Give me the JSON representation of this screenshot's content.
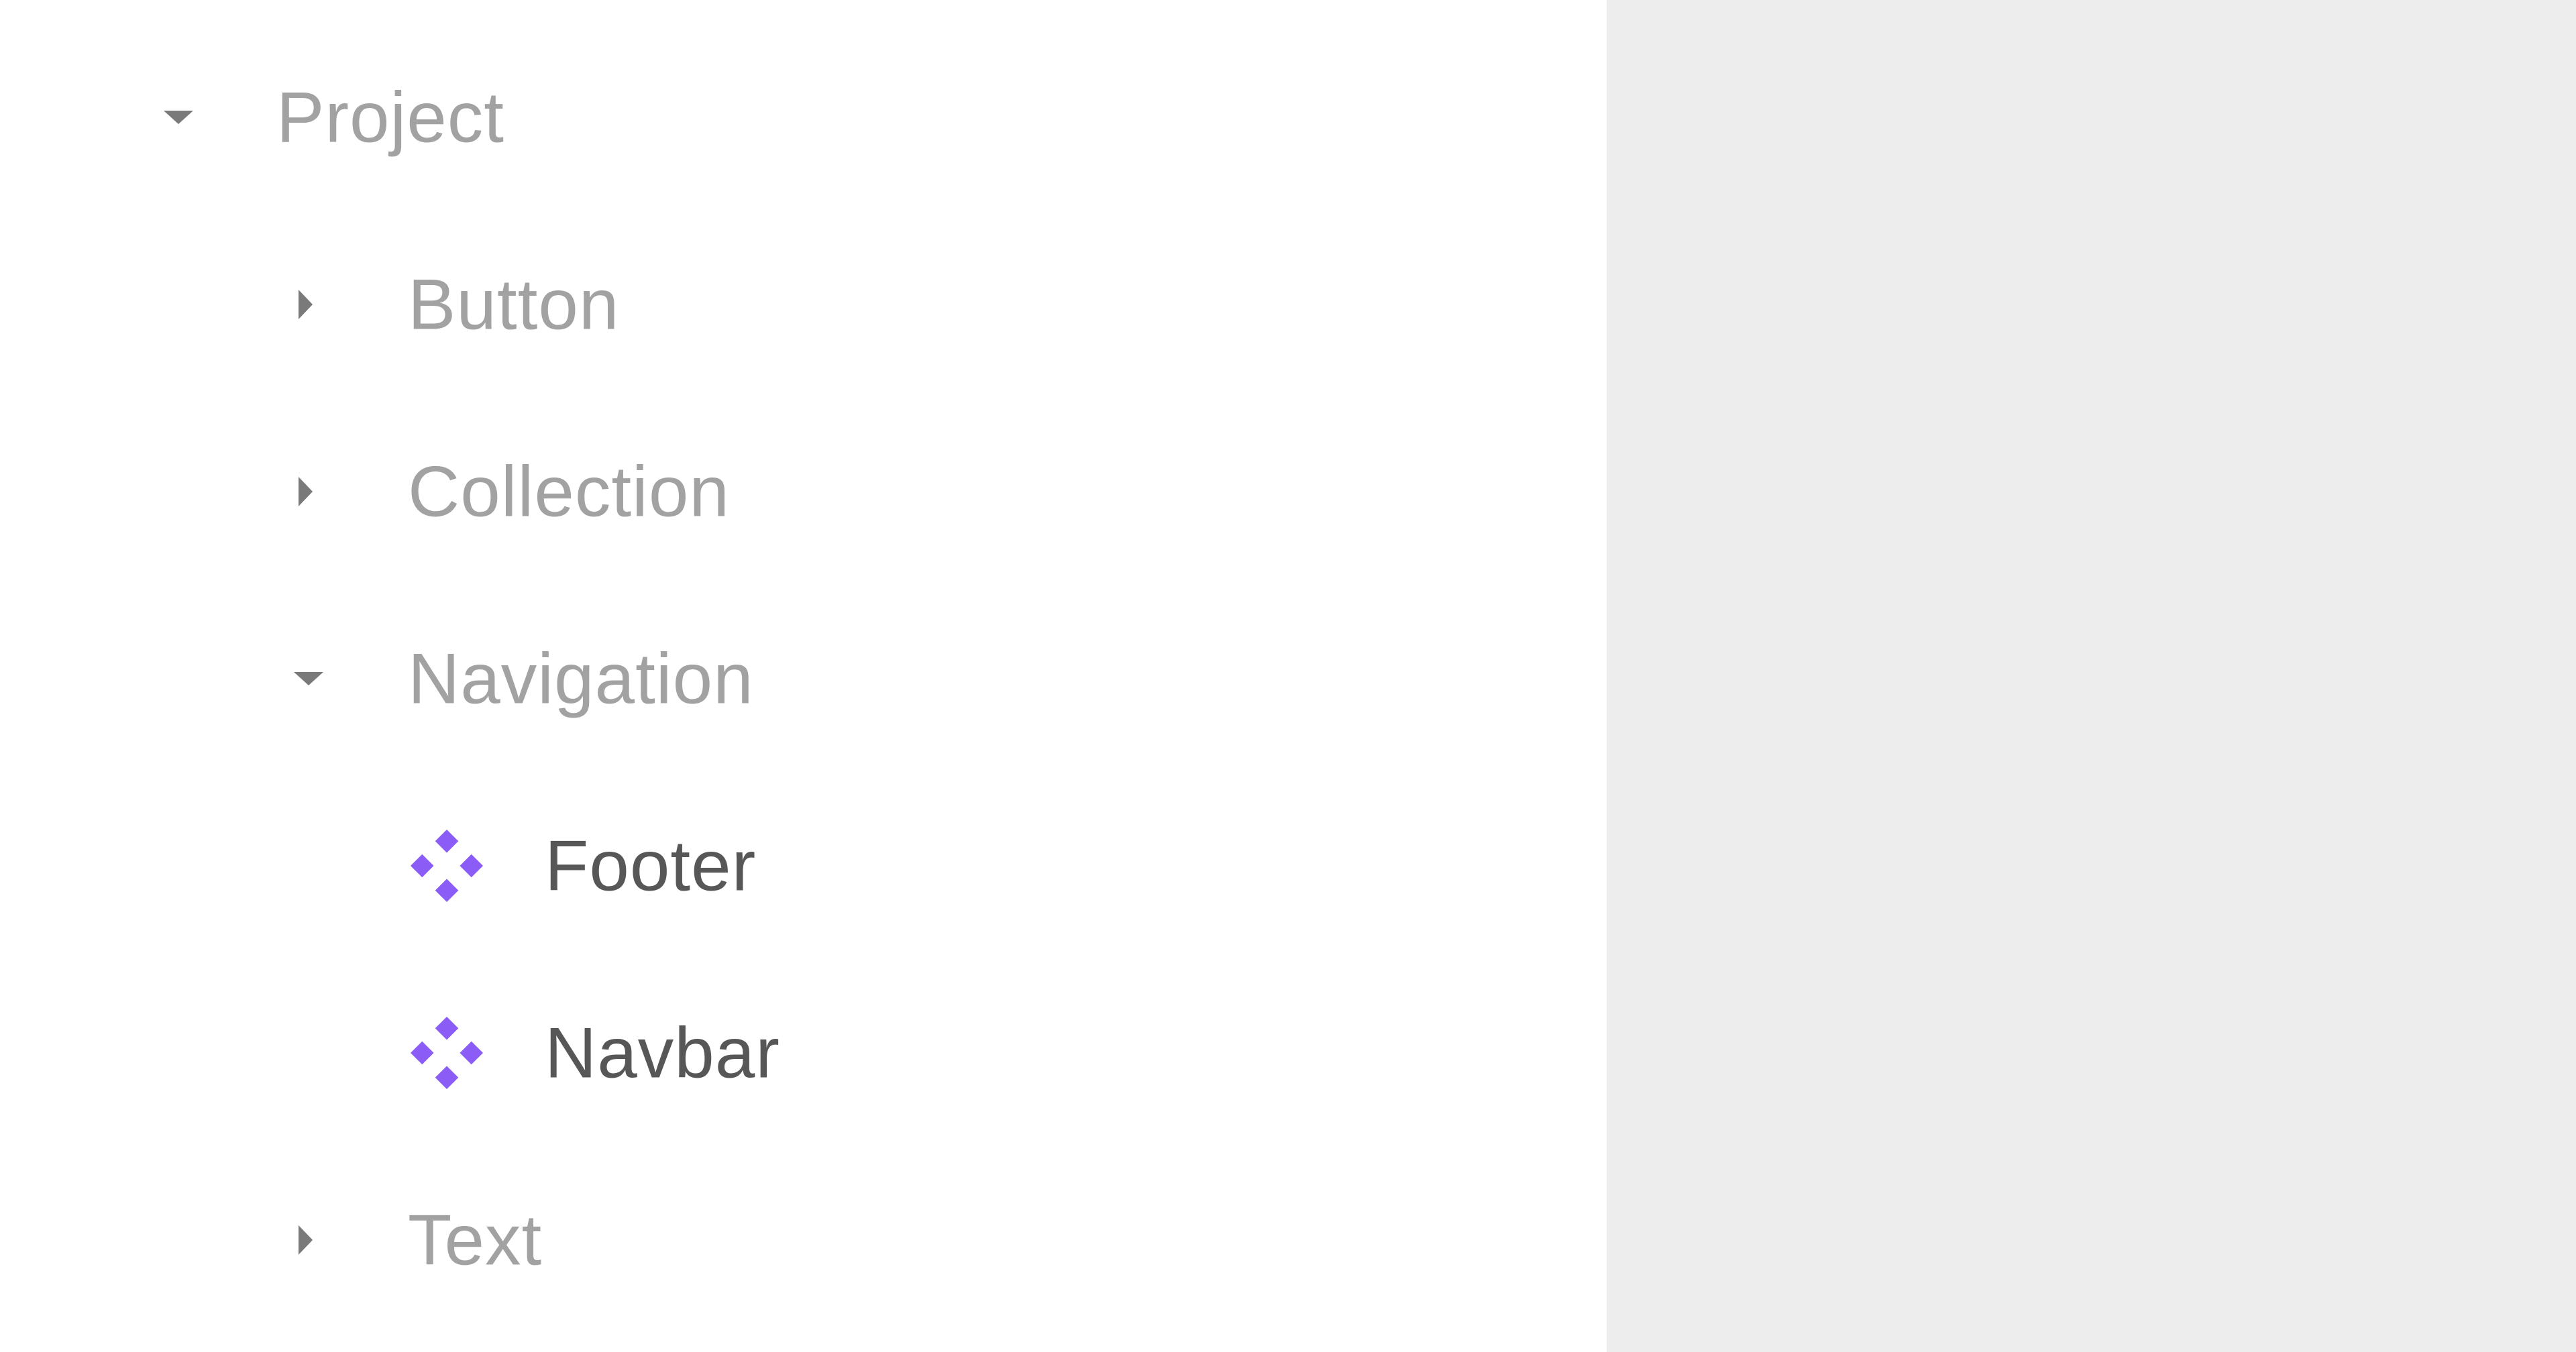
{
  "layers": {
    "root": {
      "label": "Project",
      "expanded": true,
      "chevron_icon": "chevron-down-icon"
    },
    "groups": [
      {
        "label": "Button",
        "expanded": false,
        "chevron_icon": "chevron-right-icon"
      },
      {
        "label": "Collection",
        "expanded": false,
        "chevron_icon": "chevron-right-icon"
      },
      {
        "label": "Navigation",
        "expanded": true,
        "chevron_icon": "chevron-down-icon"
      },
      {
        "label": "Text",
        "expanded": false,
        "chevron_icon": "chevron-right-icon"
      }
    ],
    "navigation_children": [
      {
        "label": "Footer",
        "icon": "component-icon"
      },
      {
        "label": "Navbar",
        "icon": "component-icon"
      }
    ]
  },
  "colors": {
    "panel_background": "#ffffff",
    "canvas_background": "#ededed",
    "folder_text": "#a2a2a2",
    "component_text": "#575757",
    "chevron": "#7a7a7a",
    "component_accent": "#8b5cf6"
  }
}
